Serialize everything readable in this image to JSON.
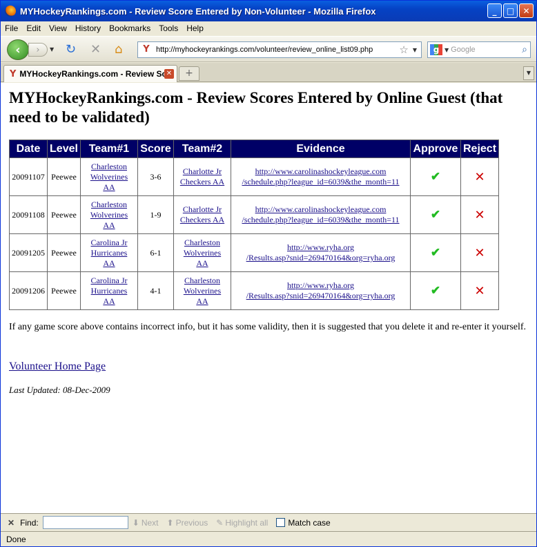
{
  "window": {
    "title": "MYHockeyRankings.com - Review Score Entered by Non-Volunteer - Mozilla Firefox"
  },
  "menu": [
    "File",
    "Edit",
    "View",
    "History",
    "Bookmarks",
    "Tools",
    "Help"
  ],
  "navbar": {
    "url": "http://myhockeyrankings.com/volunteer/review_online_list09.php",
    "search_placeholder": "Google"
  },
  "tab": {
    "label": "MYHockeyRankings.com - Review Sc..."
  },
  "page": {
    "heading": "MYHockeyRankings.com - Review Scores Entered by Online Guest (that need to be validated)",
    "table": {
      "headers": [
        "Date",
        "Level",
        "Team#1",
        "Score",
        "Team#2",
        "Evidence",
        "Approve",
        "Reject"
      ],
      "rows": [
        {
          "date": "20091107",
          "level": "Peewee",
          "team1": [
            "Charleston",
            "Wolverines",
            "AA"
          ],
          "score": "3-6",
          "team2": [
            "Charlotte Jr",
            "Checkers AA"
          ],
          "evidence": [
            "http://www.carolinashockeyleague.com",
            "/schedule.php?league_id=6039&the_month=11"
          ]
        },
        {
          "date": "20091108",
          "level": "Peewee",
          "team1": [
            "Charleston",
            "Wolverines",
            "AA"
          ],
          "score": "1-9",
          "team2": [
            "Charlotte Jr",
            "Checkers AA"
          ],
          "evidence": [
            "http://www.carolinashockeyleague.com",
            "/schedule.php?league_id=6039&the_month=11"
          ]
        },
        {
          "date": "20091205",
          "level": "Peewee",
          "team1": [
            "Carolina Jr",
            "Hurricanes",
            "AA"
          ],
          "score": "6-1",
          "team2": [
            "Charleston",
            "Wolverines",
            "AA"
          ],
          "evidence": [
            "http://www.ryha.org",
            "/Results.asp?snid=269470164&org=ryha.org"
          ]
        },
        {
          "date": "20091206",
          "level": "Peewee",
          "team1": [
            "Carolina Jr",
            "Hurricanes",
            "AA"
          ],
          "score": "4-1",
          "team2": [
            "Charleston",
            "Wolverines",
            "AA"
          ],
          "evidence": [
            "http://www.ryha.org",
            "/Results.asp?snid=269470164&org=ryha.org"
          ]
        }
      ]
    },
    "note": "If any game score above contains incorrect info, but it has some validity, then it is suggested that you delete it and re-enter it yourself.",
    "home_link": "Volunteer Home Page",
    "last_updated": "Last Updated: 08-Dec-2009"
  },
  "findbar": {
    "label": "Find:",
    "next": "Next",
    "previous": "Previous",
    "highlight": "Highlight all",
    "match_case": "Match case"
  },
  "status": "Done",
  "colors": {
    "table_header_bg": "#000066",
    "link": "#1a0f8a",
    "approve": "#22bb22",
    "reject": "#cc0000"
  }
}
